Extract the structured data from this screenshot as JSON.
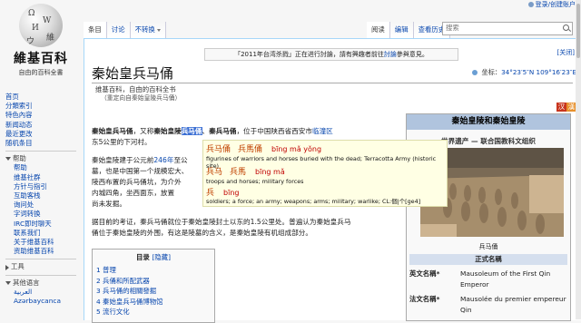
{
  "logo": {
    "name": "維基百科",
    "slogan": "自由的百科全書"
  },
  "personal": {
    "login": "登录/创建账户"
  },
  "nav": {
    "main": [
      "首页",
      "分類索引",
      "特色內容",
      "新闻动态",
      "最近更改",
      "随机条目"
    ],
    "help_header": "帮助",
    "help": [
      "帮助",
      "维基社群",
      "方针与指引",
      "互助客栈",
      "询问处",
      "字词转换",
      "IRC即时聊天",
      "联系我们",
      "关于维基百科",
      "资助维基百科"
    ],
    "tools": "工具",
    "languages_header": "其他语言",
    "languages": [
      "العربية",
      "Azərbaycanca"
    ]
  },
  "tabs": {
    "left": [
      {
        "label": "条目",
        "selected": true
      },
      {
        "label": "讨论",
        "selected": false
      },
      {
        "label": "不转换",
        "selected": false,
        "dropdown": true
      }
    ],
    "right": [
      {
        "label": "阅读",
        "selected": true
      },
      {
        "label": "编辑",
        "selected": false
      },
      {
        "label": "查看历史",
        "selected": false
      }
    ]
  },
  "search": {
    "placeholder": "搜索"
  },
  "notice": {
    "before": "「2011年台湾杀戮」正在进行討論，請有興趣者前往",
    "link": "討論",
    "after": "參與意見。",
    "close": "[关闭]"
  },
  "article": {
    "title": "秦始皇兵马俑",
    "coords_label": "坐标：",
    "coords": "34°23′5″N 109°16′23″E",
    "from": "维基百科，自由的百科全书",
    "redirect": "（重定向自秦始皇陵兵马俑）",
    "hanzi": [
      "汉",
      "漢"
    ],
    "p1": {
      "b1": "秦始皇兵马俑",
      "t1": "，又称",
      "b2": "秦始皇陵",
      "hl": "兵马俑",
      "t2": "、",
      "b3": "秦兵马俑",
      "t3": "，位于中国陕西省西安市",
      "link1": "临潼区",
      "t4": "东5公里的下河村。"
    },
    "p2": {
      "l1": "秦始皇陵建于公元前",
      "link": "246年",
      "l1b": "至公",
      "l2": "墓，也是中国第一个规模宏大、",
      "l3": "陵西布置的兵马俑坑，为介外",
      "l4": "内城四角，坐西面东，放置",
      "l5": "尚未发掘。"
    },
    "p3": {
      "l1": "据目前的考证，秦兵马俑就位于秦始皇陵封土以东的1.5公里处。普遍认为秦始皇兵马",
      "l2": "俑位于秦始皇陵的外围，有这是陵墓的含义，是秦始皇陵有机组成部分。"
    },
    "toc": {
      "title": "目录",
      "toggle": "[隐藏]",
      "items": [
        "1 普理",
        "2 兵俑和所配武器",
        "3 兵马俑的相關發掘",
        "4 秦始皇兵马俑博物馆",
        "5 流行文化"
      ]
    }
  },
  "popup": [
    {
      "simp": "兵马俑",
      "trad": "兵馬俑",
      "pinyin": "bīng mǎ yǒng",
      "def": "figurines of warriors and horses buried with the dead; Terracotta Army (historic site)"
    },
    {
      "simp": "兵马",
      "trad": "兵馬",
      "pinyin": "bīng mǎ",
      "def": "troops and horses; military forces"
    },
    {
      "simp": "兵",
      "trad": "",
      "pinyin": "bīng",
      "def": "soldiers; a force; an army; weapons; arms; military; warlike; CL:個|个[ge4]"
    }
  ],
  "infobox": {
    "title": "秦始皇陵和秦始皇陵",
    "subtitle": "世界遗产 — 联合国教科文组织",
    "caption": "兵马俑",
    "section": "正式名稱",
    "rows": [
      {
        "k": "英文名稱*",
        "v": "Mausoleum of the First Qin Emperor"
      },
      {
        "k": "法文名稱*",
        "v": "Mausolée du premier empereur Qin"
      }
    ]
  },
  "colors": {
    "link": "#0645ad",
    "highlight": "#3b6fd4",
    "infobox_header": "#b0c4de",
    "popup_bg": "#ffffe4",
    "popup_word": "#c04000",
    "pinyin": "#c00000"
  }
}
